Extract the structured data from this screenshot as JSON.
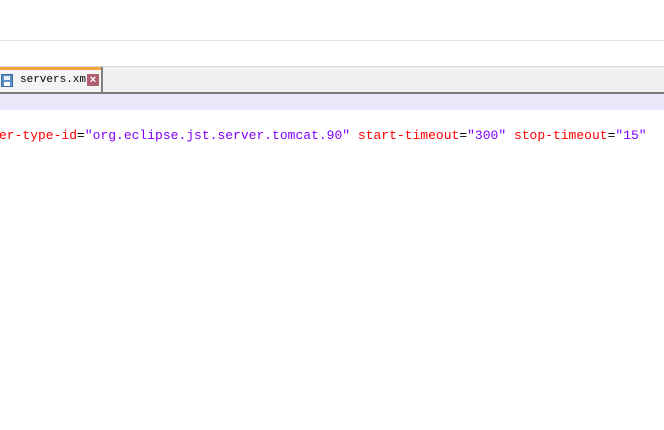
{
  "editor": {
    "tab": {
      "label": "servers.xml",
      "icon": "save-icon",
      "close_icon": "close-icon"
    },
    "code_line": [
      {
        "attr": "er-type-id",
        "value": "\"org.eclipse.jst.server.tomcat.90\""
      },
      {
        "attr": "start-timeout",
        "value": "\"300\""
      },
      {
        "attr": "stop-timeout",
        "value": "\"15\""
      }
    ],
    "equals": "="
  },
  "colors": {
    "attr": "#ff0000",
    "value": "#8000ff",
    "tab_accent": "#f5a440",
    "highlight_band": "#e8e8fa"
  }
}
